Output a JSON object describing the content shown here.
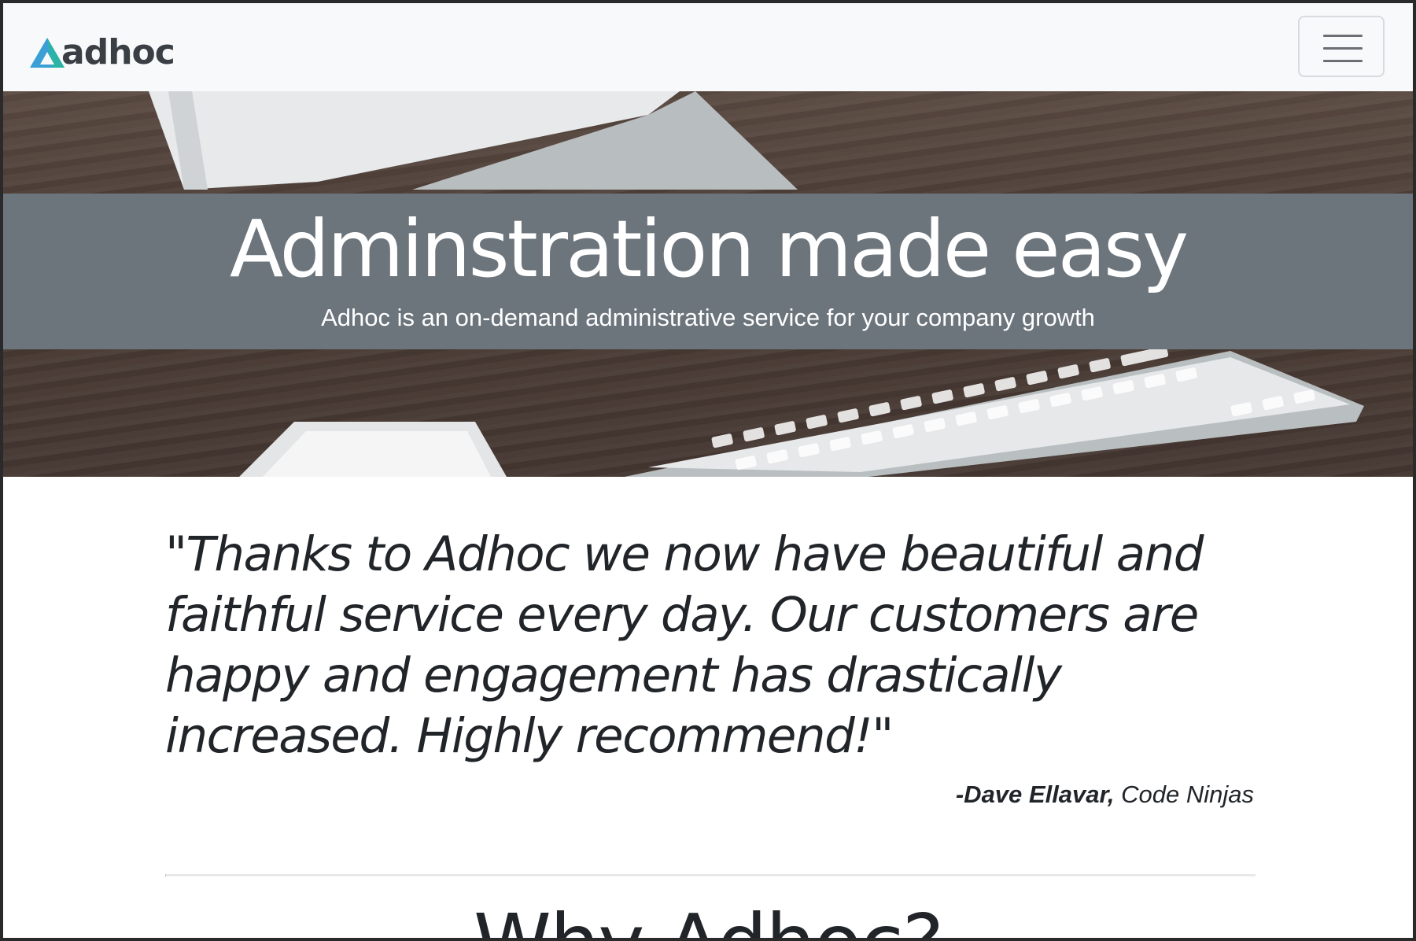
{
  "navbar": {
    "brand": "adhoc",
    "brand_icon": "triangle-logo-icon",
    "toggle_icon": "hamburger-menu-icon",
    "colors": {
      "background": "#f8f9fa",
      "logo_blue": "#3aa0d6",
      "logo_teal": "#2bb3a6",
      "brand_text": "#3a3f45"
    }
  },
  "hero": {
    "title": "Adminstration made easy",
    "subtitle": "Adhoc is an on-demand administrative service for your company growth",
    "band_color": "#6c747c"
  },
  "testimonial": {
    "quote": "\"Thanks to Adhoc we now have beautiful and faithful service every day. Our customers are happy and engagement has drastically increased. Highly recommend!\"",
    "author_name": "-Dave Ellavar,",
    "author_company": "Code Ninjas"
  },
  "section": {
    "title": "Why Adhoc?"
  }
}
